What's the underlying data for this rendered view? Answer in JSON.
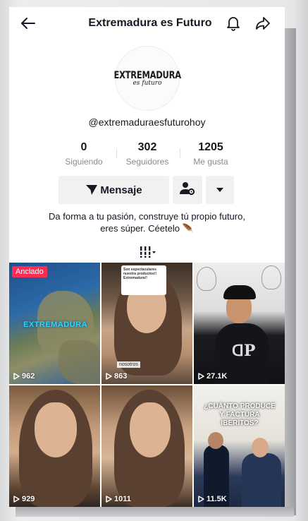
{
  "header": {
    "title": "Extremadura es Futuro",
    "back_icon": "arrow-left-icon",
    "bell_icon": "bell-icon",
    "share_icon": "share-arrow-icon"
  },
  "profile": {
    "logo_main": "EXTREMADURA",
    "logo_sub": "es futuro",
    "username": "@extremaduraesfuturohoy",
    "stats": [
      {
        "value": "0",
        "label": "Siguiendo"
      },
      {
        "value": "302",
        "label": "Seguidores"
      },
      {
        "value": "1205",
        "label": "Me gusta"
      }
    ],
    "message_button": "Mensaje",
    "bio_line1": "Da forma a tu pasión, construye tú propio futuro,",
    "bio_line2": "eres súper. Céetelo 🪶"
  },
  "videos": [
    {
      "views": "962",
      "pinned": "Anclado",
      "overlay": "EXTREMADURA"
    },
    {
      "views": "863",
      "comment": "Son espectaculares nuestra productos!! Extremadura!!",
      "chip": "nosotros"
    },
    {
      "views": "27.1K"
    },
    {
      "views": "929"
    },
    {
      "views": "1011"
    },
    {
      "views": "11.5K",
      "overlay": "¿CUÁNTO PRODUCE Y FACTURA IBERITOS?"
    }
  ],
  "colors": {
    "pinned_badge": "#fe2c55",
    "text_primary": "#161823",
    "text_secondary": "#8a8b91",
    "button_bg": "#f1f1f2"
  }
}
